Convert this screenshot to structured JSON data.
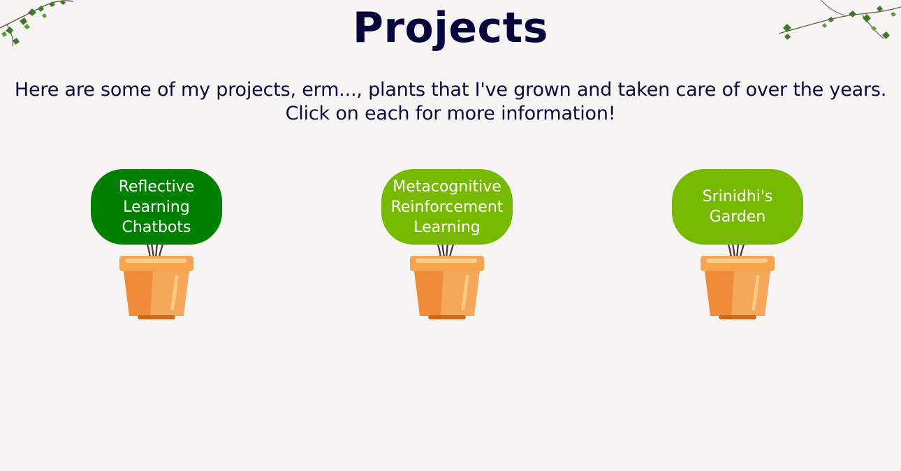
{
  "page": {
    "title": "Projects",
    "intro_line1": "Here are some of my projects, erm..., plants that I've grown and taken care of over the years.",
    "intro_line2": "Click on each for more information!"
  },
  "projects": [
    {
      "label": "Reflective Learning Chatbots",
      "color": "#008000",
      "icon": "potted-plant-icon"
    },
    {
      "label": "Metacognitive Reinforcement Learning",
      "color": "#77b900",
      "icon": "potted-plant-icon"
    },
    {
      "label": "Srinidhi's Garden",
      "color": "#77b900",
      "icon": "potted-plant-icon"
    }
  ],
  "decorations": {
    "left": "ivy-vine-icon",
    "right": "ivy-vine-icon"
  },
  "colors": {
    "background": "#f7f5f4",
    "text": "#0b0a3a",
    "pot": "#f39a48"
  }
}
